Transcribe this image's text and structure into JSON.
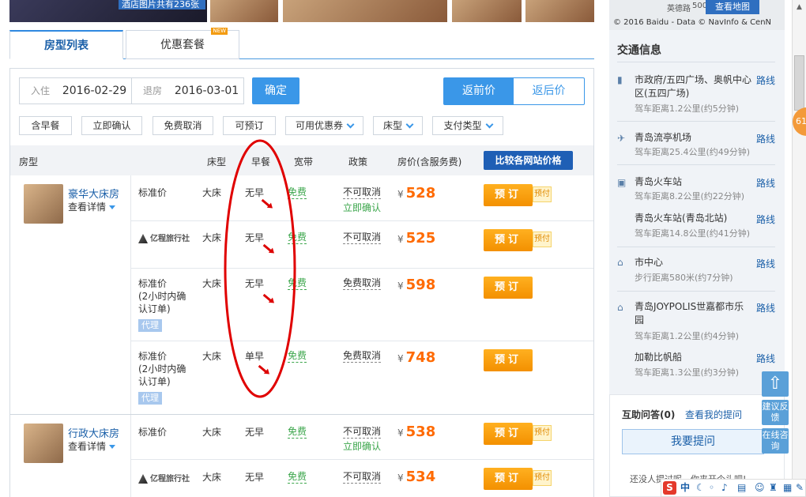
{
  "gallery": {
    "caption": "酒店图片共有236张"
  },
  "tabs": [
    {
      "label": "房型列表"
    },
    {
      "label": "优惠套餐",
      "badge": "NEW"
    }
  ],
  "search": {
    "checkin_label": "入住",
    "checkin_value": "2016-02-29",
    "checkout_label": "退房",
    "checkout_value": "2016-03-01",
    "confirm_label": "确定"
  },
  "price_toggle": {
    "before": "返前价",
    "after": "返后价"
  },
  "filters": [
    {
      "label": "含早餐"
    },
    {
      "label": "立即确认"
    },
    {
      "label": "免费取消"
    },
    {
      "label": "可预订"
    },
    {
      "label": "可用优惠券"
    },
    {
      "label": "床型"
    },
    {
      "label": "支付类型"
    }
  ],
  "table_headers": {
    "room": "房型",
    "bed": "床型",
    "breakfast": "早餐",
    "wifi": "宽带",
    "policy": "政策",
    "price": "房价(含服务费)",
    "compare": "比较各网站价格"
  },
  "rooms": [
    {
      "name": "豪华大床房",
      "details": "查看详情",
      "rates": [
        {
          "type": "标准价",
          "bed": "大床",
          "breakfast": "无早",
          "wifi": "免费",
          "policy": "不可取消",
          "instant": "立即确认",
          "currency": "¥",
          "price": "528",
          "book": "预订",
          "prepay": "预付"
        },
        {
          "type": "亿程旅行社",
          "bed": "大床",
          "breakfast": "无早",
          "wifi": "免费",
          "policy": "不可取消",
          "currency": "¥",
          "price": "525",
          "book": "预订",
          "prepay": "预付"
        },
        {
          "type": "标准价\n(2小时内确认订单)",
          "type_lines": [
            "标准价",
            "(2小时内确",
            "认订单)"
          ],
          "agent": "代理",
          "bed": "大床",
          "breakfast": "无早",
          "wifi": "免费",
          "policy": "免费取消",
          "currency": "¥",
          "price": "598",
          "book": "预订"
        },
        {
          "type_lines": [
            "标准价",
            "(2小时内确",
            "认订单)"
          ],
          "agent": "代理",
          "bed": "大床",
          "breakfast": "单早",
          "wifi": "免费",
          "policy": "免费取消",
          "currency": "¥",
          "price": "748",
          "book": "预订"
        }
      ]
    },
    {
      "name": "行政大床房",
      "details": "查看详情",
      "rates": [
        {
          "type": "标准价",
          "bed": "大床",
          "breakfast": "无早",
          "wifi": "免费",
          "policy": "不可取消",
          "instant": "立即确认",
          "currency": "¥",
          "price": "538",
          "book": "预订",
          "prepay": "预付"
        },
        {
          "type": "亿程旅行社",
          "bed": "大床",
          "breakfast": "无早",
          "wifi": "免费",
          "policy": "不可取消",
          "currency": "¥",
          "price": "534",
          "book": "预订",
          "prepay": "预付"
        }
      ]
    }
  ],
  "map": {
    "copyright": "© 2016 Baidu - Data © NavInfo & CenN",
    "place": "英德路",
    "scale": "500",
    "view_map": "查看地图"
  },
  "traffic": {
    "title": "交通信息",
    "link_label": "路线",
    "items": [
      {
        "name_lines": [
          "市政府/五四广场、奥帆中心",
          "区(五四广场)"
        ],
        "dist": "驾车距离1.2公里(约5分钟)",
        "icon": "bus-icon"
      },
      {
        "name_lines": [
          "青岛流亭机场"
        ],
        "dist": "驾车距离25.4公里(约49分钟)",
        "icon": "plane-icon"
      },
      {
        "name_lines": [
          "青岛火车站"
        ],
        "dist": "驾车距离8.2公里(约22分钟)",
        "icon": "train-icon"
      },
      {
        "name_lines": [
          "青岛火车站(青岛北站)"
        ],
        "dist": "驾车距离14.8公里(约41分钟)"
      },
      {
        "name_lines": [
          "市中心"
        ],
        "dist": "步行距离580米(约7分钟)",
        "icon": "city-icon"
      },
      {
        "name_lines": [
          "青岛JOYPOLIS世嘉都市乐",
          "园"
        ],
        "dist": "驾车距离1.2公里(约4分钟)",
        "icon": "landmark-icon"
      },
      {
        "name_lines": [
          "加勒比帆船"
        ],
        "dist": "驾车距离1.3公里(约3分钟)"
      }
    ]
  },
  "qa": {
    "title": "互助问答",
    "count": "(0)",
    "my_questions": "查看我的提问",
    "ask_button": "我要提问",
    "empty_text": "还没人提过呢，你来开个头吧!"
  },
  "float_tools": {
    "feedback": "建议反馈",
    "consult": "在线咨询",
    "badge": "61"
  },
  "ime": {
    "lang": "中"
  }
}
